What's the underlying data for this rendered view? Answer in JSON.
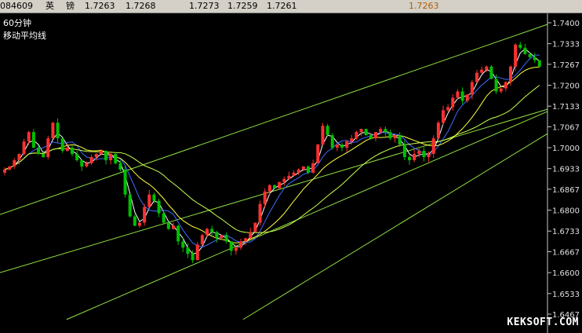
{
  "header": {
    "code": "084609",
    "name_1": "英",
    "name_2": "镑",
    "v1": "1.7263",
    "v2": "1.7268",
    "v3": "1.7273",
    "v4": "1.7259",
    "v5": "1.7261",
    "last": "1.7263"
  },
  "chart_data": {
    "type": "candlestick",
    "title": "60分钟",
    "subtitle": "移动平均线",
    "yticks": [
      "1.7400",
      "1.7333",
      "1.7267",
      "1.7200",
      "1.7133",
      "1.7067",
      "1.7000",
      "1.6933",
      "1.6867",
      "1.6800",
      "1.6733",
      "1.6667",
      "1.6600",
      "1.6533",
      "1.6467"
    ],
    "ylim": [
      1.6467,
      1.74
    ],
    "grid": false,
    "colors": {
      "up": "#ff3030",
      "down": "#00c000",
      "ma_fast": "#ffffff",
      "ma_mid": "#3a6cff",
      "ma_slow": "#ffff40",
      "ma_long": "#c8ff50",
      "trendline": "#90e040",
      "axis": "#c8c8c8"
    },
    "closes": [
      1.693,
      1.694,
      1.696,
      1.698,
      1.702,
      1.705,
      1.7,
      1.698,
      1.697,
      1.703,
      1.708,
      1.703,
      1.699,
      1.7,
      1.698,
      1.696,
      1.694,
      1.695,
      1.697,
      1.698,
      1.699,
      1.696,
      1.698,
      1.695,
      1.693,
      1.685,
      1.678,
      1.675,
      1.676,
      1.681,
      1.685,
      1.683,
      1.679,
      1.676,
      1.674,
      1.675,
      1.67,
      1.668,
      1.666,
      1.664,
      1.669,
      1.672,
      1.674,
      1.673,
      1.671,
      1.672,
      1.67,
      1.667,
      1.668,
      1.67,
      1.671,
      1.673,
      1.676,
      1.682,
      1.686,
      1.688,
      1.687,
      1.689,
      1.69,
      1.691,
      1.692,
      1.693,
      1.694,
      1.692,
      1.695,
      1.701,
      1.707,
      1.704,
      1.7,
      1.701,
      1.7,
      1.702,
      1.703,
      1.705,
      1.706,
      1.704,
      1.703,
      1.705,
      1.706,
      1.705,
      1.703,
      1.704,
      1.701,
      1.697,
      1.696,
      1.698,
      1.699,
      1.697,
      1.698,
      1.703,
      1.708,
      1.712,
      1.713,
      1.716,
      1.718,
      1.715,
      1.717,
      1.721,
      1.724,
      1.725,
      1.726,
      1.722,
      1.718,
      1.719,
      1.721,
      1.726,
      1.733,
      1.732,
      1.73,
      1.729,
      1.728,
      1.726
    ]
  }
}
